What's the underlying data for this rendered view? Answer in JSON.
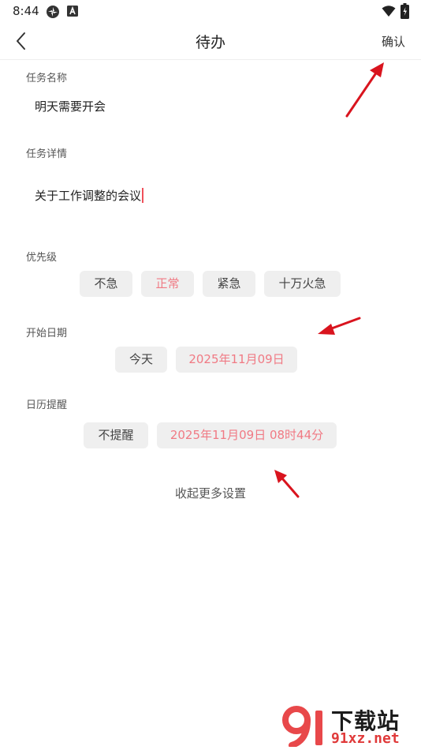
{
  "status_bar": {
    "time": "8:44",
    "icons": [
      "settings-app-icon",
      "a-app-icon",
      "wifi-icon",
      "battery-icon"
    ]
  },
  "header": {
    "title": "待办",
    "back_icon": "chevron-left-icon",
    "confirm_label": "确认"
  },
  "task_name": {
    "label": "任务名称",
    "value": "明天需要开会"
  },
  "task_detail": {
    "label": "任务详情",
    "value": "关于工作调整的会议"
  },
  "priority": {
    "label": "优先级",
    "options": [
      "不急",
      "正常",
      "紧急",
      "十万火急"
    ],
    "selected": "正常"
  },
  "start_date": {
    "label": "开始日期",
    "today_label": "今天",
    "date_value": "2025年11月09日"
  },
  "calendar_reminder": {
    "label": "日历提醒",
    "none_label": "不提醒",
    "datetime_value": "2025年11月09日  08时44分"
  },
  "collapse_label": "收起更多设置",
  "watermark": {
    "logo": "91",
    "title": "下载站",
    "url": "91xz.net"
  },
  "colors": {
    "accent": "#f07a84",
    "chip_bg": "#efefef",
    "annotation_arrow": "#d9141e",
    "caret": "#f0505a"
  }
}
